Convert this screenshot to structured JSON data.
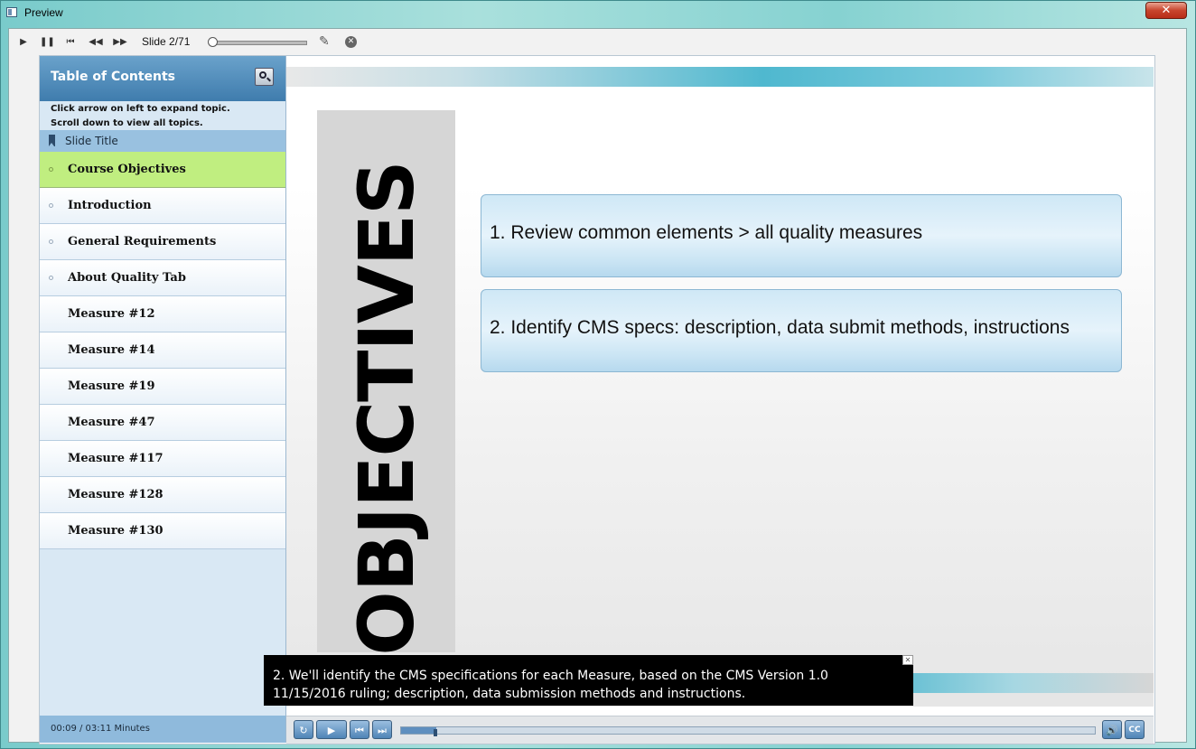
{
  "window": {
    "title": "Preview",
    "close_label": "✕"
  },
  "preview_toolbar": {
    "slide_counter": "Slide 2/71",
    "buttons": [
      "play-icon",
      "pause-icon",
      "first-slide-icon",
      "rewind-icon",
      "fast-forward-icon"
    ],
    "position_fraction": 0.0
  },
  "toc": {
    "title": "Table of Contents",
    "instructions_line1": "Click arrow on left to expand topic.",
    "instructions_line2": "Scroll down to view all topics.",
    "column_header": "Slide Title",
    "items": [
      {
        "label": "Course Objectives",
        "active": true,
        "dot": true
      },
      {
        "label": "Introduction",
        "active": false,
        "dot": true
      },
      {
        "label": "General Requirements",
        "active": false,
        "dot": true
      },
      {
        "label": "About Quality Tab",
        "active": false,
        "dot": true
      },
      {
        "label": "Measure #12",
        "active": false,
        "dot": false
      },
      {
        "label": "Measure #14",
        "active": false,
        "dot": false
      },
      {
        "label": "Measure #19",
        "active": false,
        "dot": false
      },
      {
        "label": "Measure #47",
        "active": false,
        "dot": false
      },
      {
        "label": "Measure #117",
        "active": false,
        "dot": false
      },
      {
        "label": "Measure #128",
        "active": false,
        "dot": false
      },
      {
        "label": "Measure #130",
        "active": false,
        "dot": false
      }
    ],
    "time": "00:09 / 03:11 Minutes"
  },
  "slide": {
    "heading": "OBJECTIVES",
    "objectives": [
      "1.  Review common elements > all quality measures",
      "2.  Identify CMS specs: description, data submit methods, instructions"
    ]
  },
  "caption": {
    "text": "2. We'll identify the CMS specifications for each Measure, based on the CMS Version 1.0 11/15/2016 ruling; description, data submission methods and instructions."
  },
  "playbar": {
    "progress_fraction": 0.05,
    "buttons": [
      "replay-icon",
      "play-icon",
      "previous-slide-icon",
      "next-slide-icon",
      "volume-icon",
      "closed-captions-icon"
    ],
    "cc_label": "CC"
  },
  "colors": {
    "active_item": "#c0ee80",
    "toc_header": "#4f89b8",
    "caption_bg": "#000000"
  }
}
